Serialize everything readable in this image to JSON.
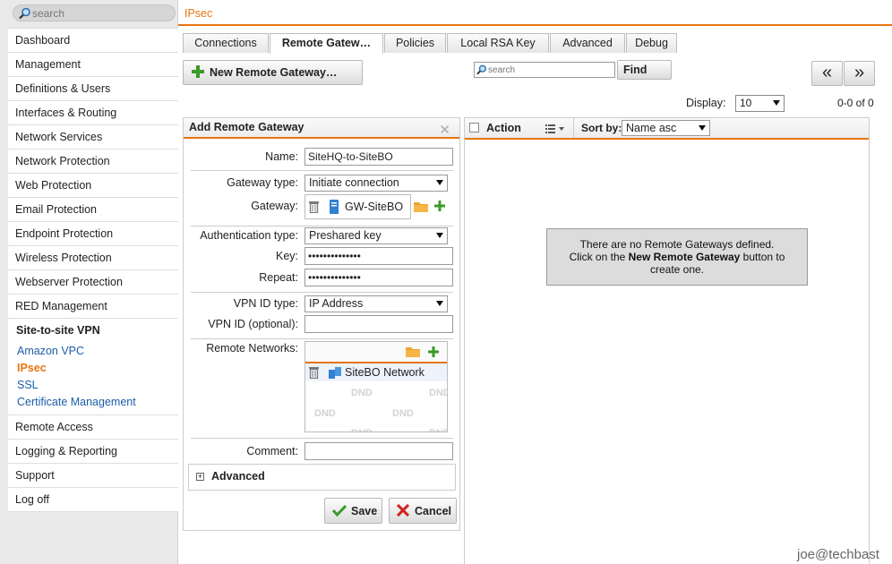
{
  "sidebar": {
    "search_placeholder": "search",
    "items_top": [
      "Dashboard",
      "Management",
      "Definitions & Users",
      "Interfaces & Routing",
      "Network Services",
      "Network Protection",
      "Web Protection",
      "Email Protection",
      "Endpoint Protection",
      "Wireless Protection",
      "Webserver Protection",
      "RED Management"
    ],
    "group_title": "Site-to-site VPN",
    "group_items": [
      "Amazon VPC",
      "IPsec",
      "SSL",
      "Certificate Management"
    ],
    "items_bottom": [
      "Remote Access",
      "Logging & Reporting",
      "Support",
      "Log off"
    ]
  },
  "header": {
    "breadcrumb": "IPsec"
  },
  "tabs": [
    "Connections",
    "Remote Gatew…",
    "Policies",
    "Local RSA Key",
    "Advanced",
    "Debug"
  ],
  "toolbar": {
    "new_button": "New Remote Gateway…",
    "search_placeholder": "search",
    "find_button": "Find",
    "prev_button": "«",
    "next_button": "»",
    "display_label": "Display:",
    "display_value": "10",
    "pager_count": "0-0 of 0"
  },
  "add_panel": {
    "title": "Add Remote Gateway",
    "name_label": "Name:",
    "name_value": "SiteHQ-to-SiteBO",
    "gateway_type_label": "Gateway type:",
    "gateway_type_value": "Initiate connection",
    "gateway_label": "Gateway:",
    "gateway_value": "GW-SiteBO",
    "auth_type_label": "Authentication type:",
    "auth_type_value": "Preshared key",
    "key_label": "Key:",
    "key_value": "••••••••••••••",
    "repeat_label": "Repeat:",
    "repeat_value": "••••••••••••••",
    "vpn_id_type_label": "VPN ID type:",
    "vpn_id_type_value": "IP Address",
    "vpn_id_label": "VPN ID (optional):",
    "vpn_id_value": "",
    "remote_networks_label": "Remote Networks:",
    "remote_network_item": "SiteBO Network",
    "dnd_text": "DND",
    "comment_label": "Comment:",
    "comment_value": "",
    "advanced_label": "Advanced",
    "save_button": "Save",
    "cancel_button": "Cancel"
  },
  "list_panel": {
    "action_label": "Action",
    "sortby_label": "Sort by:",
    "sortby_value": "Name asc",
    "empty_line1": "There are no Remote Gateways defined.",
    "empty_line2_pre": "Click on the ",
    "empty_line2_bold": "New Remote Gateway",
    "empty_line2_post": " button to",
    "empty_line3": "create one."
  },
  "footer": {
    "user": "joe@techbast"
  },
  "colors": {
    "accent": "#e87511",
    "link": "#1a5ea8",
    "add_green": "#3a9a2a",
    "cancel_red": "#d0231e"
  }
}
